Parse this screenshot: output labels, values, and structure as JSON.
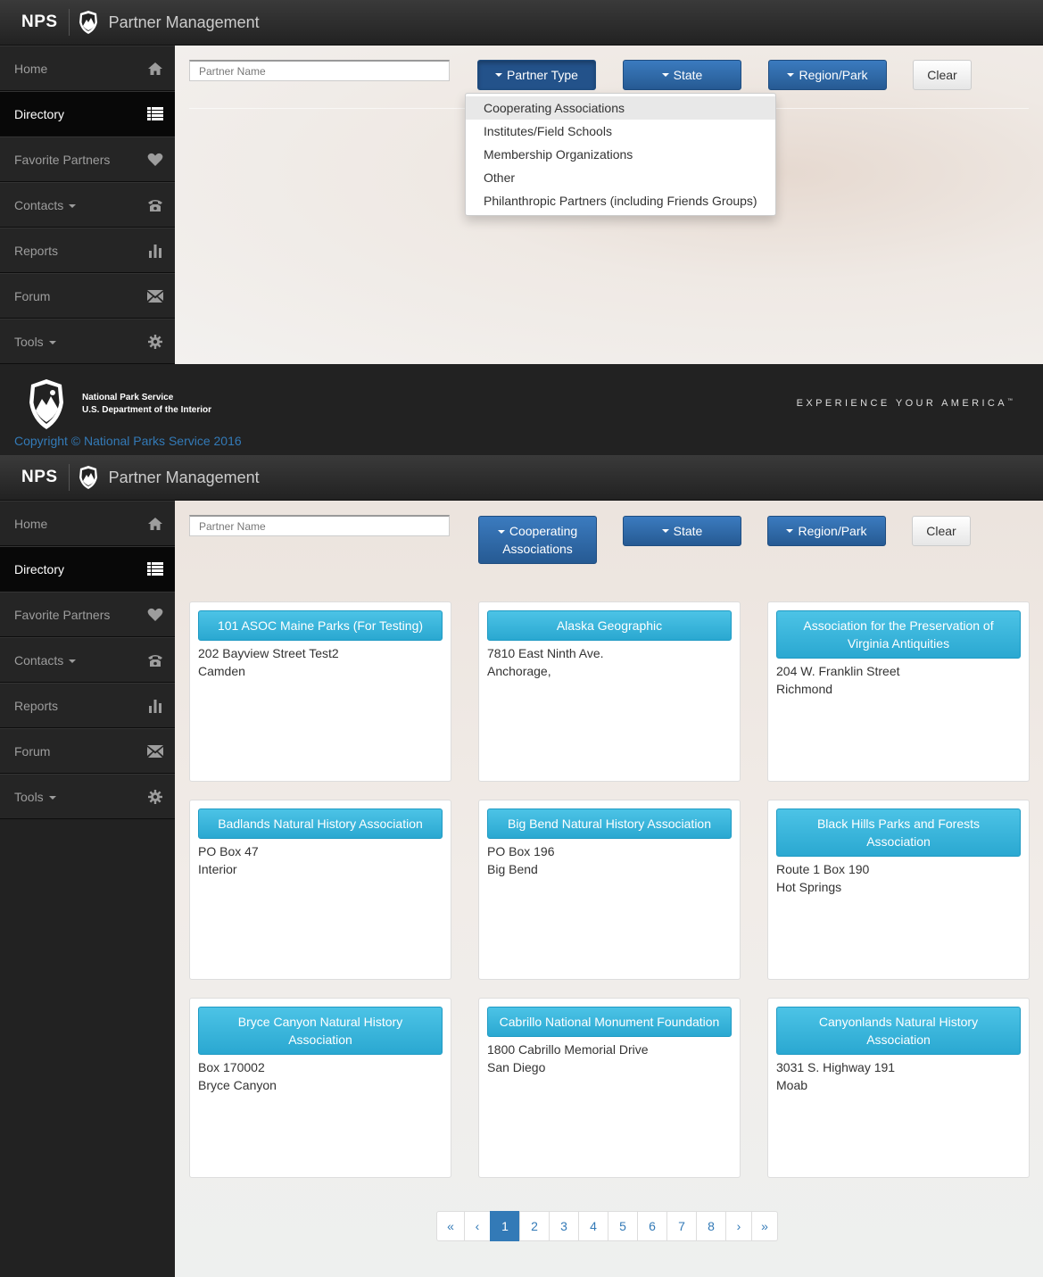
{
  "app": {
    "brand": "NPS",
    "title": "Partner Management"
  },
  "sidebar": {
    "items": [
      {
        "label": "Home",
        "icon": "home-icon",
        "caret": false
      },
      {
        "label": "Directory",
        "icon": "list-icon",
        "caret": false,
        "active": true
      },
      {
        "label": "Favorite Partners",
        "icon": "heart-icon",
        "caret": false
      },
      {
        "label": "Contacts",
        "icon": "phone-icon",
        "caret": true
      },
      {
        "label": "Reports",
        "icon": "bar-chart-icon",
        "caret": false
      },
      {
        "label": "Forum",
        "icon": "envelope-icon",
        "caret": false
      },
      {
        "label": "Tools",
        "icon": "gear-icon",
        "caret": true
      }
    ]
  },
  "filters_top": {
    "search_placeholder": "Partner Name",
    "partner_type": "Partner Type",
    "state": "State",
    "region": "Region/Park",
    "clear": "Clear"
  },
  "dropdown": {
    "items": [
      "Cooperating Associations",
      "Institutes/Field Schools",
      "Membership Organizations",
      "Other",
      "Philanthropic Partners (including Friends Groups)"
    ]
  },
  "footer": {
    "org_line1": "National Park Service",
    "org_line2": "U.S. Department of the Interior",
    "slogan": "EXPERIENCE YOUR AMERICA",
    "slogan_tm": "™",
    "copyright": "Copyright © National Parks Service 2016"
  },
  "filters_bottom": {
    "search_placeholder": "Partner Name",
    "partner_type": "Cooperating Associations",
    "state": "State",
    "region": "Region/Park",
    "clear": "Clear"
  },
  "cards": [
    {
      "name": "101 ASOC Maine Parks (For Testing)",
      "address": "202 Bayview Street Test2",
      "city": "Camden"
    },
    {
      "name": "Alaska Geographic",
      "address": "7810 East Ninth Ave.",
      "city": "Anchorage,"
    },
    {
      "name": "Association for the Preservation of Virginia Antiquities",
      "address": "204 W. Franklin Street",
      "city": "Richmond"
    },
    {
      "name": "Badlands Natural History Association",
      "address": "PO Box 47",
      "city": "Interior"
    },
    {
      "name": "Big Bend Natural History Association",
      "address": "PO Box 196",
      "city": "Big Bend"
    },
    {
      "name": "Black Hills Parks and Forests Association",
      "address": "Route 1 Box 190",
      "city": "Hot Springs"
    },
    {
      "name": "Bryce Canyon Natural History Association",
      "address": "Box 170002",
      "city": "Bryce Canyon"
    },
    {
      "name": "Cabrillo National Monument Foundation",
      "address": "1800 Cabrillo Memorial Drive",
      "city": "San Diego"
    },
    {
      "name": "Canyonlands Natural History Association",
      "address": "3031 S. Highway 191",
      "city": "Moab"
    }
  ],
  "pagination": {
    "first": "«",
    "prev": "‹",
    "pages": [
      "1",
      "2",
      "3",
      "4",
      "5",
      "6",
      "7",
      "8"
    ],
    "active": "1",
    "next": "›",
    "last": "»"
  }
}
